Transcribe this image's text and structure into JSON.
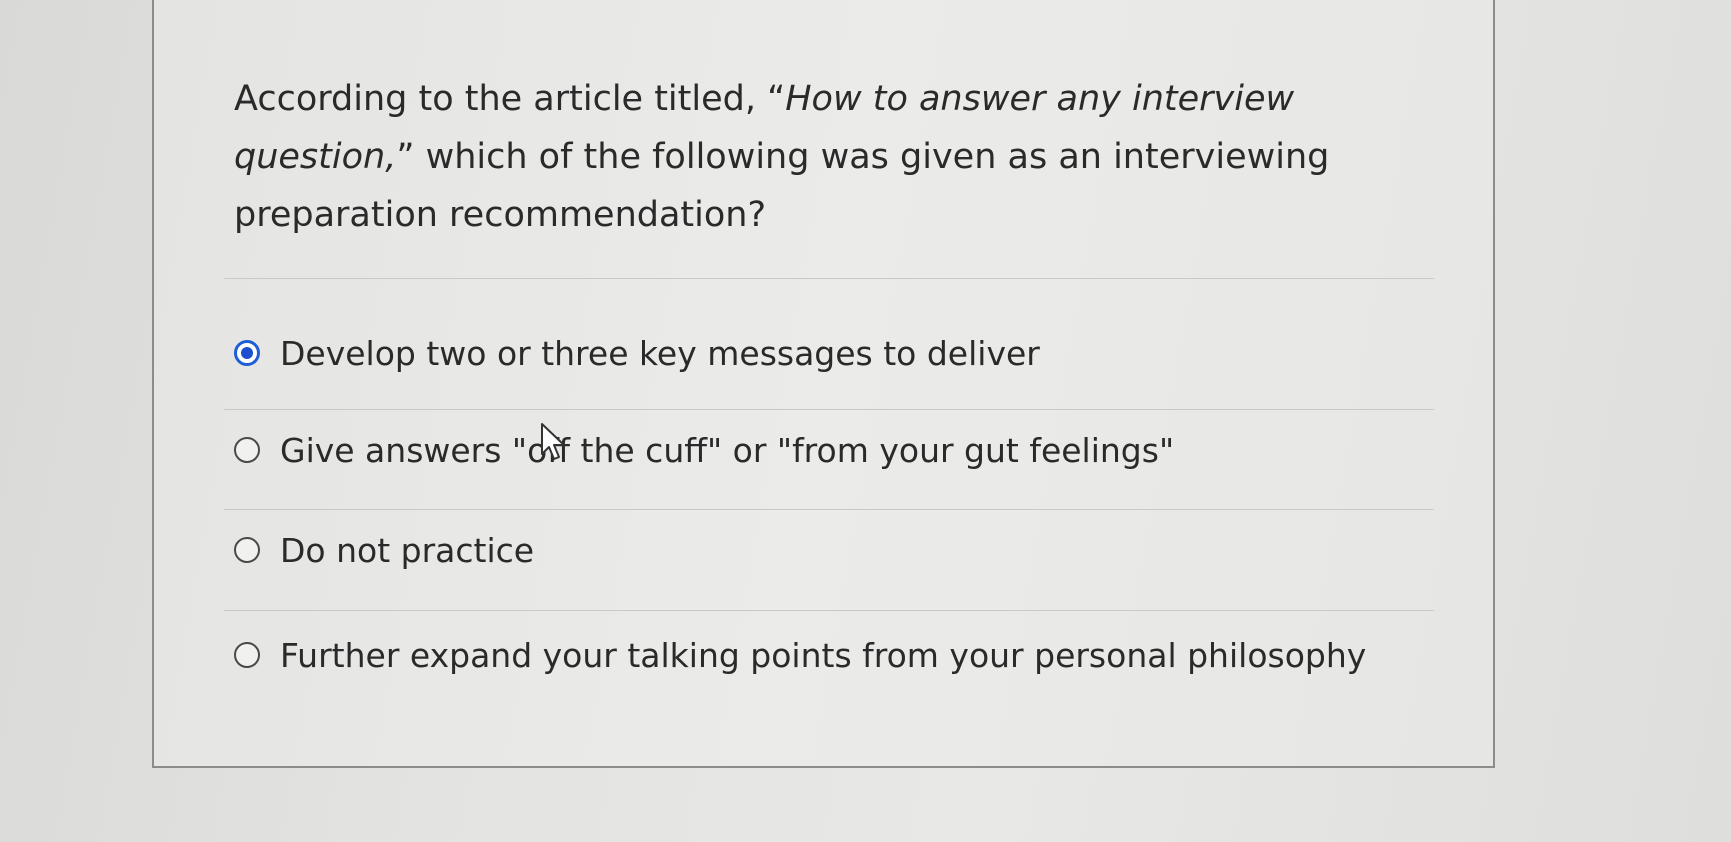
{
  "question": {
    "prefix": "According to the article titled, “",
    "article_title": "How to answer any interview question,",
    "suffix": "” which of the following was given as an interviewing preparation recommendation?"
  },
  "options": [
    {
      "label": "Develop two or three key messages to deliver",
      "selected": true
    },
    {
      "label": "Give answers \"off the cuff\" or \"from your gut feelings\"",
      "selected": false
    },
    {
      "label": "Do not practice",
      "selected": false
    },
    {
      "label": "Further expand your talking points from your personal philosophy",
      "selected": false
    }
  ],
  "colors": {
    "radio_selected": "#1c4fd0",
    "card_border": "#8c8c8c"
  },
  "icons": {
    "cursor": "mouse-pointer-icon"
  }
}
